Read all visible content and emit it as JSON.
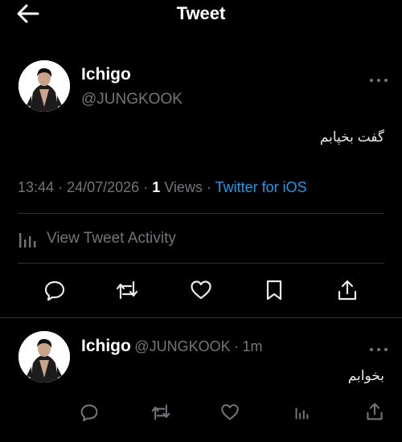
{
  "header": {
    "title": "Tweet"
  },
  "main_tweet": {
    "name": "Ichigo",
    "handle": "@JUNGKOOK",
    "text": "گفت بخپابم",
    "time": "13:44",
    "separator": "·",
    "date": "24/07/2026",
    "views_count": "1",
    "views_label": "Views",
    "source": "Twitter for iOS",
    "activity_label": "View Tweet Activity"
  },
  "reply": {
    "name": "Ichigo",
    "handle": "@JUNGKOOK",
    "separator": "·",
    "age": "1m",
    "text": "بخوابم"
  },
  "icons": {
    "back": "arrow-left-icon",
    "more": "more-horizontal-icon",
    "reply": "reply-bubble-icon",
    "retweet": "retweet-icon",
    "like": "heart-icon",
    "bookmark": "bookmark-icon",
    "share": "share-icon",
    "analytics": "analytics-icon"
  },
  "colors": {
    "background": "#000000",
    "text": "#e7e9ea",
    "muted": "#71767b",
    "accent": "#1d9bf0",
    "divider": "#2f3336"
  }
}
